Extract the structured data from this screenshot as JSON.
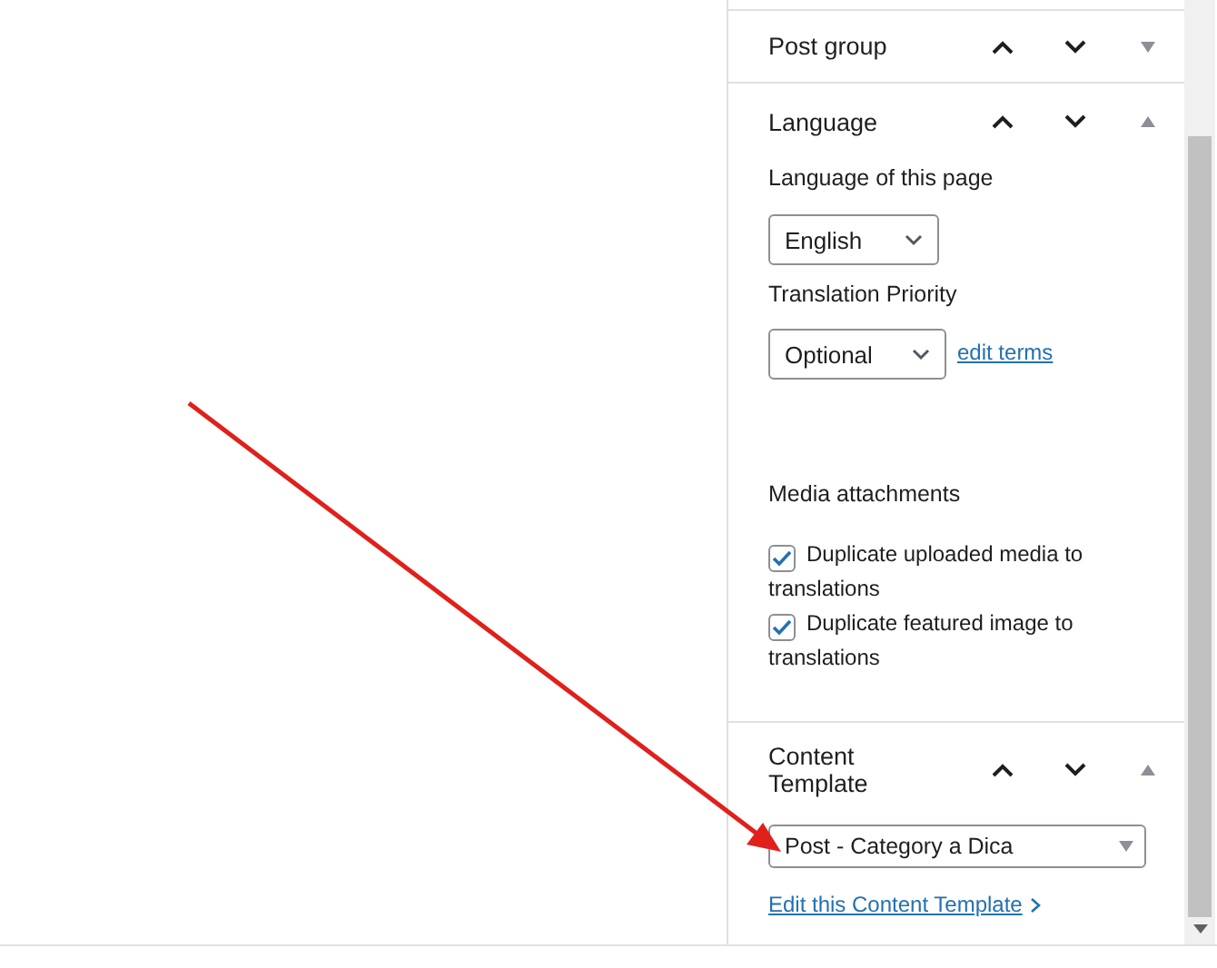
{
  "panels": [
    {
      "kind": "simple",
      "title": "Post group",
      "expanded": false
    },
    {
      "kind": "language",
      "title": "Language",
      "expanded": true,
      "language_label": "Language of this page",
      "language_select": "English",
      "priority_label": "Translation Priority",
      "priority_select": "Optional",
      "edit_link": "edit terms",
      "media_label": "Media attachments",
      "options": [
        {
          "label": "Duplicate uploaded media to translations",
          "checked": true
        },
        {
          "label": "Duplicate featured image to translations",
          "checked": true
        }
      ]
    },
    {
      "kind": "template",
      "title": "Content Template",
      "expanded": true,
      "template_select": "Post - Category a Dica",
      "edit_link": "Edit this Content Template"
    }
  ]
}
